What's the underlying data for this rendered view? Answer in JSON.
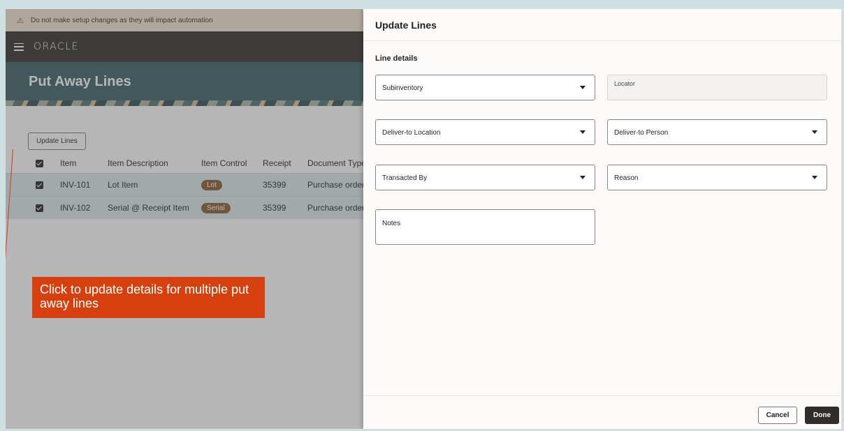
{
  "warning": {
    "text": "Do not make setup changes as they will impact automation"
  },
  "header": {
    "logo": "ORACLE"
  },
  "page": {
    "title": "Put Away Lines",
    "update_button": "Update Lines"
  },
  "table": {
    "headers": [
      "Item",
      "Item Description",
      "Item Control",
      "Receipt",
      "Document Type"
    ],
    "rows": [
      {
        "item": "INV-101",
        "description": "Lot Item",
        "control": "Lot",
        "receipt": "35399",
        "doc_type": "Purchase order"
      },
      {
        "item": "INV-102",
        "description": "Serial @ Receipt Item",
        "control": "Serial",
        "receipt": "35399",
        "doc_type": "Purchase order"
      }
    ]
  },
  "callout": {
    "text": "Click to update details for multiple put away lines"
  },
  "drawer": {
    "title": "Update Lines",
    "section": "Line details",
    "fields": {
      "subinventory": "Subinventory",
      "locator": "Locator",
      "deliver_location": "Deliver-to Location",
      "deliver_person": "Deliver-to Person",
      "transacted_by": "Transacted By",
      "reason": "Reason",
      "notes": "Notes"
    },
    "cancel": "Cancel",
    "done": "Done"
  },
  "colors": {
    "accent": "#d6400f",
    "banner": "#3a5d63",
    "topbar": "#312d2a",
    "badge": "#8a5a2b"
  }
}
